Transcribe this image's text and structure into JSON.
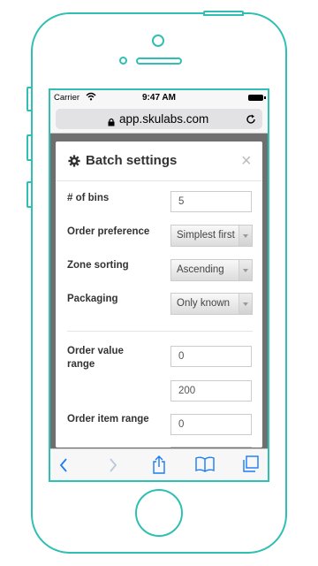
{
  "status_bar": {
    "carrier": "Carrier",
    "time": "9:47 AM"
  },
  "browser": {
    "url": "app.skulabs.com"
  },
  "modal": {
    "title": "Batch settings",
    "close_label": "×",
    "fields": {
      "bins": {
        "label": "# of bins",
        "value": "5"
      },
      "order_preference": {
        "label": "Order preference",
        "value": "Simplest first"
      },
      "zone_sorting": {
        "label": "Zone sorting",
        "value": "Ascending"
      },
      "packaging": {
        "label": "Packaging",
        "value": "Only known"
      },
      "order_value_range": {
        "label_line1": "Order value",
        "label_line2": "range",
        "min": "0",
        "max": "200"
      },
      "order_item_range": {
        "label": "Order item range",
        "min": "0"
      }
    }
  },
  "icons": {
    "status": [
      "wifi-icon",
      "battery-icon"
    ],
    "browser": [
      "lock-icon",
      "reload-icon"
    ],
    "modal": [
      "gear-icon",
      "close-icon"
    ],
    "toolbar": [
      "back-icon",
      "forward-icon",
      "share-icon",
      "bookmarks-icon",
      "tabs-icon"
    ]
  },
  "colors": {
    "device_outline": "#2fbfb3",
    "browser_chrome": "#f7f7f7",
    "accent": "#1a7cf5",
    "overlay": "#6f6f6f"
  }
}
